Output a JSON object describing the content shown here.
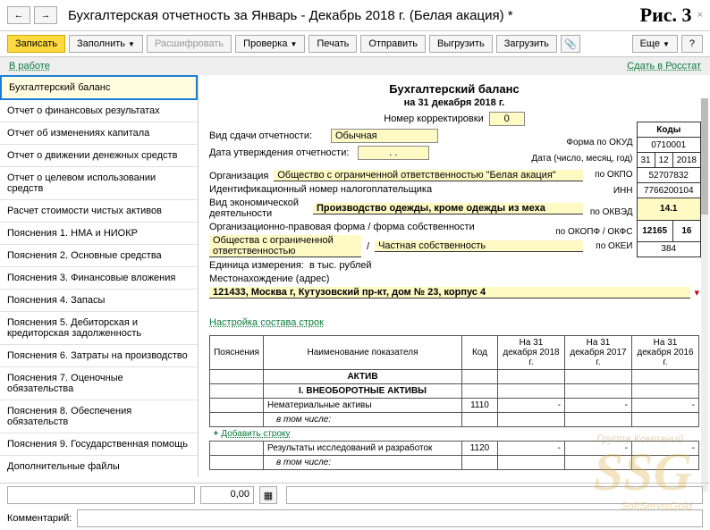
{
  "header": {
    "title": "Бухгалтерская отчетность за Январь - Декабрь 2018 г. (Белая акация) *",
    "fig": "Рис. 3"
  },
  "toolbar": {
    "save": "Записать",
    "fill": "Заполнить",
    "decode": "Расшифровать",
    "check": "Проверка",
    "print": "Печать",
    "send": "Отправить",
    "upload": "Выгрузить",
    "download": "Загрузить",
    "more": "Еще",
    "help": "?"
  },
  "status": {
    "in_work": "В работе",
    "submit": "Сдать в Росстат"
  },
  "sidebar": {
    "items": [
      "Бухгалтерский баланс",
      "Отчет о финансовых результатах",
      "Отчет об изменениях капитала",
      "Отчет о движении денежных средств",
      "Отчет о целевом использовании средств",
      "Расчет стоимости чистых активов",
      "Пояснения 1. НМА и НИОКР",
      "Пояснения 2. Основные средства",
      "Пояснения 3. Финансовые вложения",
      "Пояснения 4. Запасы",
      "Пояснения 5. Дебиторская и кредиторская задолженность",
      "Пояснения 6. Затраты на производство",
      "Пояснения 7. Оценочные обязательства",
      "Пояснения 8. Обеспечения обязательств",
      "Пояснения 9. Государственная помощь",
      "Дополнительные файлы"
    ]
  },
  "form": {
    "title": "Бухгалтерский баланс",
    "subtitle": "на 31 декабря 2018 г.",
    "correction_label": "Номер корректировки",
    "correction_value": "0",
    "submission_label": "Вид сдачи отчетности:",
    "submission_value": "Обычная",
    "approval_label": "Дата утверждения отчетности:",
    "approval_value": ".  .",
    "org_label": "Организация",
    "org_value": "Общество с ограниченной ответственностью \"Белая акация\"",
    "inn_label": "Идентификационный номер налогоплательщика",
    "activity_label": "Вид экономической деятельности",
    "activity_value": "Производство одежды, кроме одежды из меха",
    "legal_form_label": "Организационно-правовая форма / форма собственности",
    "legal_form_value1": "Общества с ограниченной ответственностью",
    "legal_form_value2": "Частная собственность",
    "unit_label": "Единица измерения:",
    "unit_value": "в тыс. рублей",
    "address_label": "Местонахождение (адрес)",
    "address_value": "121433, Москва г, Кутузовский пр-кт, дом № 23, корпус 4",
    "settings_link": "Настройка состава строк"
  },
  "codes": {
    "header": "Коды",
    "okud_label": "Форма по ОКУД",
    "okud": "0710001",
    "date_label": "Дата (число, месяц, год)",
    "date_d": "31",
    "date_m": "12",
    "date_y": "2018",
    "okpo_label": "по ОКПО",
    "okpo": "52707832",
    "inn_label": "ИНН",
    "inn": "7766200104",
    "okved_label": "по ОКВЭД",
    "okved": "14.1",
    "okopf_label": "по ОКОПФ / ОКФС",
    "okopf1": "12165",
    "okopf2": "16",
    "okei_label": "по ОКЕИ",
    "okei": "384"
  },
  "table": {
    "headers": [
      "Пояснения",
      "Наименование показателя",
      "Код",
      "На 31 декабря 2018 г.",
      "На 31 декабря 2017 г.",
      "На 31 декабря 2016 г."
    ],
    "section1": "АКТИВ",
    "section2": "I. ВНЕОБОРОТНЫЕ АКТИВЫ",
    "rows": [
      {
        "name": "Нематериальные активы",
        "code": "1110",
        "sub": "в том числе:"
      },
      {
        "name": "Результаты исследований и разработок",
        "code": "1120",
        "sub": "в том числе:"
      }
    ],
    "add_row": "Добавить строку"
  },
  "footer": {
    "value": "0,00",
    "comment_label": "Комментарий:"
  },
  "watermark": {
    "main": "SSG",
    "sub": "SoftServisGold",
    "top": "Группа Компаний"
  }
}
